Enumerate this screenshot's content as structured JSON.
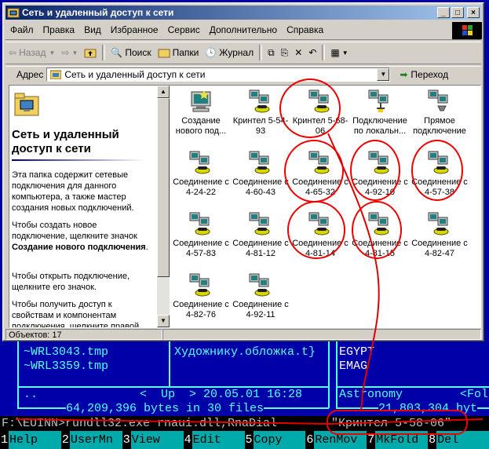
{
  "window": {
    "title": "Сеть и удаленный доступ к сети",
    "menu": [
      "Файл",
      "Правка",
      "Вид",
      "Избранное",
      "Сервис",
      "Дополнительно",
      "Справка"
    ],
    "toolbar": {
      "back": "Назад",
      "search": "Поиск",
      "folders": "Папки",
      "journal": "Журнал"
    },
    "address": {
      "label": "Адрес",
      "value": "Сеть и удаленный доступ к сети",
      "go": "Переход"
    },
    "left_pane": {
      "title": "Сеть и удаленный доступ к сети",
      "p1": "Эта папка содержит сетевые подключения для данного компьютера, а также мастер создания новых подключений.",
      "p2_pre": "Чтобы создать новое подключение, щелкните значок",
      "p2_bold": "Создание нового подключения",
      "p2_post": ".",
      "p3": "Чтобы открыть подключение, щелкните его значок.",
      "p4": "Чтобы получить доступ к свойствам и компонентам подключения, щелкните правой"
    },
    "items": [
      {
        "label": "Создание нового под...",
        "icon": "new-connection-icon"
      },
      {
        "label": "Кринтел 5-54-93",
        "icon": "dialup-icon"
      },
      {
        "label": "Кринтел 5-68-06",
        "icon": "dialup-icon"
      },
      {
        "label": "Подключение по локальн...",
        "icon": "lan-icon"
      },
      {
        "label": "Прямое подключение",
        "icon": "direct-icon"
      },
      {
        "label": "Соединение с 4-24-22",
        "icon": "dialup-icon"
      },
      {
        "label": "Соединение с 4-60-43",
        "icon": "dialup-icon"
      },
      {
        "label": "Соединение с 4-65-32",
        "icon": "dialup-icon"
      },
      {
        "label": "Соединение с 4-92-10",
        "icon": "dialup-icon"
      },
      {
        "label": "Соединение с 4-57-38",
        "icon": "dialup-icon"
      },
      {
        "label": "Соединение с 4-57-83",
        "icon": "dialup-icon"
      },
      {
        "label": "Соединение с 4-81-12",
        "icon": "dialup-icon"
      },
      {
        "label": "Соединение с 4-81-14",
        "icon": "dialup-icon"
      },
      {
        "label": "Соединение с 4-81-15",
        "icon": "dialup-icon"
      },
      {
        "label": "Соединение с 4-82-47",
        "icon": "dialup-icon"
      },
      {
        "label": "Соединение с 4-82-76",
        "icon": "dialup-icon"
      },
      {
        "label": "Соединение с 4-92-11",
        "icon": "dialup-icon"
      }
    ],
    "status": "Объектов: 17"
  },
  "dos": {
    "left_files": [
      "~WRL3043.tmp",
      "~WRL3359.tmp"
    ],
    "mid_file": "Художнику.обложка.t}",
    "right_files": [
      "EGYPT",
      "EMAG"
    ],
    "dots": "..",
    "up_info": "<  Up  > 20.05.01 16:28",
    "right_info": "Astronomy",
    "right_fold": "<Fol",
    "left_total": "64,209,396 bytes in 30 files",
    "right_total": "21,803,304 byt",
    "command_prefix": "F:\\EUINN>rundll32.exe rnaui.dll,RnaDial ",
    "command_arg": "\"Кринтел 5-58-06\"",
    "fkeys": [
      {
        "n": "1",
        "l": "Help"
      },
      {
        "n": "2",
        "l": "UserMn"
      },
      {
        "n": "3",
        "l": "View"
      },
      {
        "n": "4",
        "l": "Edit"
      },
      {
        "n": "5",
        "l": "Copy"
      },
      {
        "n": "6",
        "l": "RenMov"
      },
      {
        "n": "7",
        "l": "MkFold"
      },
      {
        "n": "8",
        "l": "Del"
      }
    ]
  },
  "colors": {
    "annotation": "#e00000",
    "dos_bg": "#0000a8",
    "title_start": "#0a246a"
  }
}
